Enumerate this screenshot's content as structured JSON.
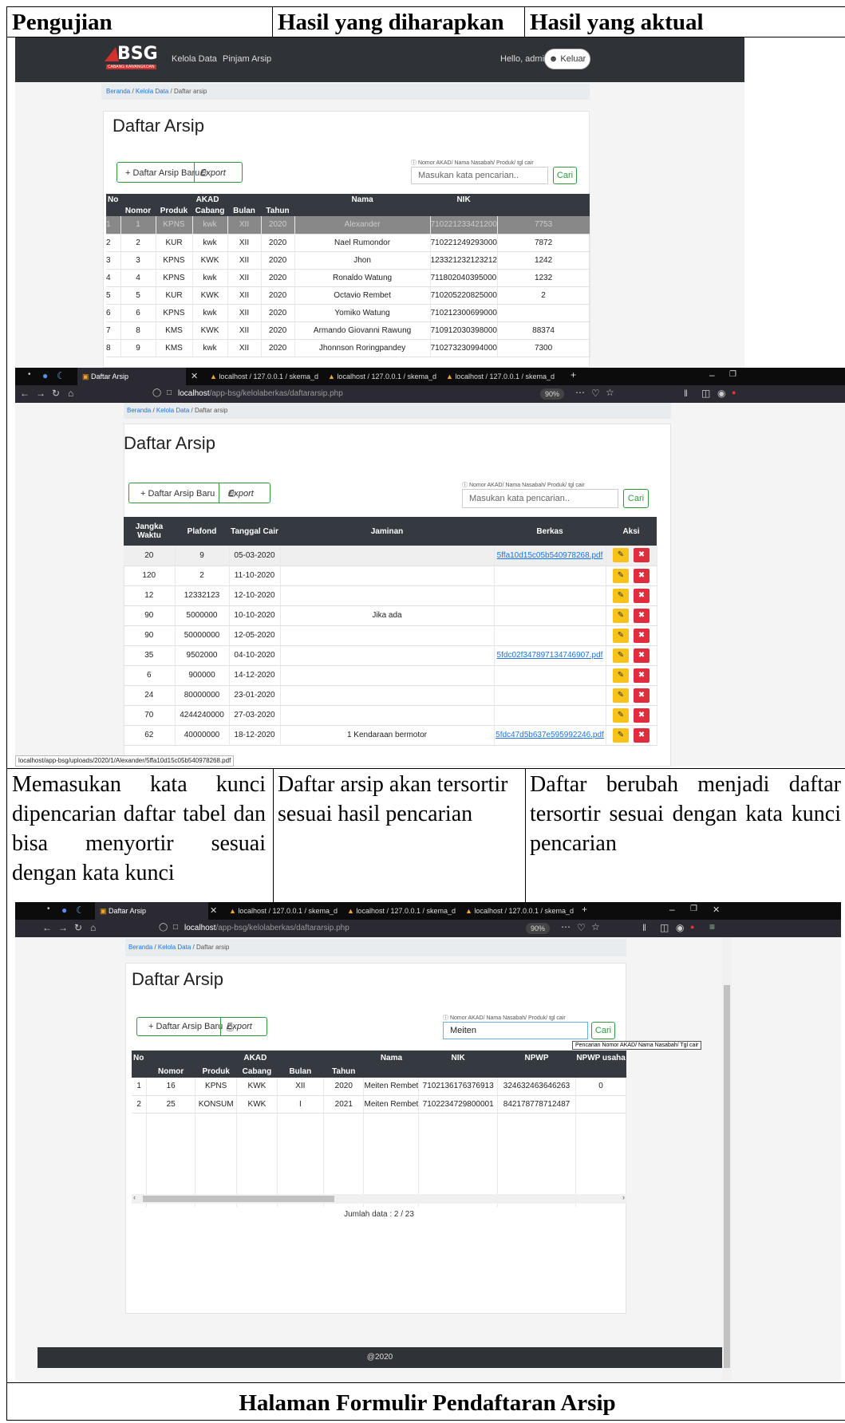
{
  "header": {
    "col1": "Pengujian",
    "col2": "Hasil yang diharapkan",
    "col3": "Hasil yang aktual"
  },
  "row2": {
    "col1": "Memasukan kata kunci dipencarian daftar tabel dan bisa menyortir sesuai dengan kata kunci",
    "col2": "Daftar arsip akan tersortir sesuai hasil pencarian",
    "col3": "Daftar berubah menjadi daftar tersortir sesuai dengan kata kunci pencarian"
  },
  "caption": "Halaman Formulir Pendaftaran Arsip",
  "app": {
    "logo": "BSG",
    "logo_sub": "CABANG KAWANGKOAN",
    "nav": [
      "Kelola Data",
      "Pinjam Arsip"
    ],
    "hello": "Hello, admin |",
    "logout": "Keluar",
    "breadcrumb": [
      "Beranda",
      "Kelola Data",
      "Daftar arsip"
    ],
    "page_title": "Daftar Arsip",
    "add_btn": "+ Daftar Arsip Baru",
    "export_btn": "Export",
    "search_label": "Nomor AKAD/ Nama Nasabah/ Produk/ tgl cair",
    "search_placeholder": "Masukan kata pencarian..",
    "search_btn": "Cari"
  },
  "shot1": {
    "headers_top": [
      "No",
      "AKAD",
      "Nama",
      "NIK"
    ],
    "headers_sub": [
      "Nomor",
      "Produk",
      "Cabang",
      "Bulan",
      "Tahun"
    ],
    "rows": [
      [
        "1",
        "1",
        "KPNS",
        "kwk",
        "XII",
        "2020",
        "Alexander",
        "7102212334212001",
        "7753"
      ],
      [
        "2",
        "2",
        "KUR",
        "kwk",
        "XII",
        "2020",
        "Nael Rumondor",
        "7102212492930001",
        "7872"
      ],
      [
        "3",
        "3",
        "KPNS",
        "KWK",
        "XII",
        "2020",
        "Jhon",
        "1233212321232123",
        "1242"
      ],
      [
        "4",
        "4",
        "KPNS",
        "kwk",
        "XII",
        "2020",
        "Ronaldo Watung",
        "7118020403950001",
        "1232"
      ],
      [
        "5",
        "5",
        "KUR",
        "KWK",
        "XII",
        "2020",
        "Octavio Rembet",
        "7102052208250001",
        "2"
      ],
      [
        "6",
        "6",
        "KPNS",
        "kwk",
        "XII",
        "2020",
        "Yomiko Watung",
        "7102123006990001",
        ""
      ],
      [
        "7",
        "8",
        "KMS",
        "KWK",
        "XII",
        "2020",
        "Armando Giovanni Rawung",
        "7109120303980001",
        "88374"
      ],
      [
        "8",
        "9",
        "KMS",
        "kwk",
        "XII",
        "2020",
        "Jhonnson Roringpandey",
        "7102732309940001",
        "7300"
      ]
    ]
  },
  "browser": {
    "tab_active": "Daftar Arsip",
    "tabs": [
      "localhost / 127.0.0.1 / skema_d",
      "localhost / 127.0.0.1 / skema_d",
      "localhost / 127.0.0.1 / skema_d"
    ],
    "url_host": "localhost",
    "url_path": "/app-bsg/kelolaberkas/daftararsip.php",
    "zoom": "90%",
    "status_url": "localhost/app-bsg/uploads/2020/1/Alexander/5ffa10d15c05b540978268.pdf"
  },
  "shot2": {
    "headers": [
      "Jangka Waktu",
      "Plafond",
      "Tanggal Cair",
      "Jaminan",
      "Berkas",
      "Aksi"
    ],
    "rows": [
      [
        "20",
        "9",
        "05-03-2020",
        "",
        "5ffa10d15c05b540978268.pdf"
      ],
      [
        "120",
        "2",
        "11-10-2020",
        "",
        ""
      ],
      [
        "12",
        "12332123",
        "12-10-2020",
        "",
        ""
      ],
      [
        "90",
        "5000000",
        "10-10-2020",
        "Jika ada",
        ""
      ],
      [
        "90",
        "50000000",
        "12-05-2020",
        "",
        ""
      ],
      [
        "35",
        "9502000",
        "04-10-2020",
        "",
        "5fdc02f347897134746907.pdf"
      ],
      [
        "6",
        "900000",
        "14-12-2020",
        "",
        ""
      ],
      [
        "24",
        "80000000",
        "23-01-2020",
        "",
        ""
      ],
      [
        "70",
        "4244240000",
        "27-03-2020",
        "",
        ""
      ],
      [
        "62",
        "40000000",
        "18-12-2020",
        "1 Kendaraan bermotor",
        "5fdc47d5b637e595992246.pdf"
      ]
    ]
  },
  "shot3": {
    "search_value": "Meiten",
    "tooltip": "Pencarian Nomor AKAD/ Nama Nasabah/ Tgl cair",
    "headers_top": [
      "No",
      "AKAD",
      "Nama",
      "NIK",
      "NPWP",
      "NPWP usaha"
    ],
    "headers_sub": [
      "Nomor",
      "Produk",
      "Cabang",
      "Bulan",
      "Tahun"
    ],
    "rows": [
      [
        "1",
        "16",
        "KPNS",
        "KWK",
        "XII",
        "2020",
        "Meiten Rembet",
        "7102136176376913",
        "324632463646263",
        "0"
      ],
      [
        "2",
        "25",
        "KONSUM",
        "KWK",
        "I",
        "2021",
        "Meiten Rembet",
        "7102234729800001",
        "842178778712487",
        ""
      ]
    ],
    "count": "Jumlah data : 2 / 23",
    "footer": "@2020"
  }
}
